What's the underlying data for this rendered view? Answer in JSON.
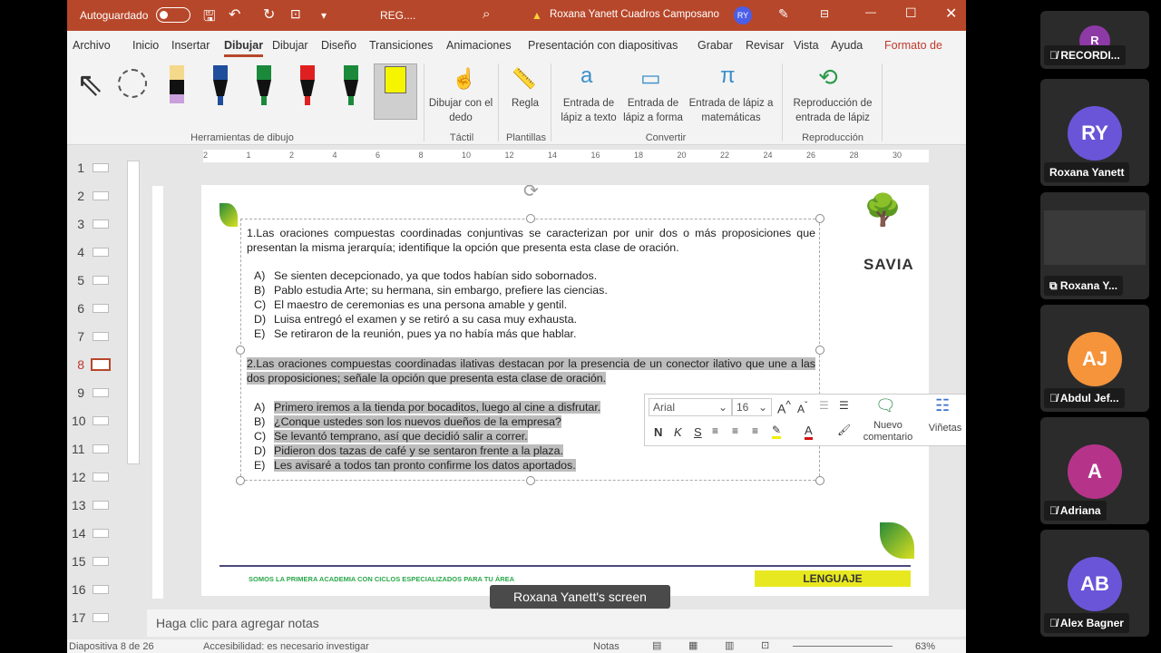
{
  "titlebar": {
    "autosave": "Autoguardado",
    "filename": "REG....",
    "user": "Roxana Yanett Cuadros Camposano",
    "user_initials": "RY",
    "accent": "#b7472a"
  },
  "tabs": [
    "Archivo",
    "Inicio",
    "Insertar",
    "Dibujar",
    "Dibujar",
    "Diseño",
    "Transiciones",
    "Animaciones",
    "Presentación con diapositivas",
    "Grabar",
    "Revisar",
    "Vista",
    "Ayuda",
    "Formato de"
  ],
  "ribbon": {
    "groups": {
      "draw_tools": "Herramientas de dibujo",
      "touch": "Táctil",
      "templates": "Plantillas",
      "convert": "Convertir",
      "replay": "Reproducción"
    },
    "buttons": {
      "draw_finger": "Dibujar con el dedo",
      "ruler": "Regla",
      "ink_text": "Entrada de lápiz a texto",
      "ink_shape": "Entrada de lápiz a forma",
      "ink_math": "Entrada de lápiz a matemáticas",
      "ink_replay": "Reproducción de entrada de lápiz"
    }
  },
  "thumbnails": [
    "1",
    "2",
    "3",
    "4",
    "5",
    "6",
    "7",
    "8",
    "9",
    "10",
    "11",
    "12",
    "13",
    "14",
    "15",
    "16",
    "17"
  ],
  "selected_slide": "8",
  "ruler_labels": [
    "2",
    "1",
    "2",
    "4",
    "6",
    "8",
    "10",
    "12",
    "14",
    "16",
    "18",
    "20",
    "22",
    "24",
    "26",
    "28",
    "30"
  ],
  "slide": {
    "q1": "1.Las oraciones compuestas coordinadas conjuntivas se caracterizan por unir dos o más proposiciones que presentan la misma jerarquía; identifique la opción que presenta esta clase de oración.",
    "q1_options": [
      [
        "A)",
        "Se sienten decepcionado, ya que todos habían sido sobornados."
      ],
      [
        "B)",
        "Pablo estudia Arte; su hermana, sin embargo, prefiere las ciencias."
      ],
      [
        "C)",
        "El maestro de ceremonias es una persona amable y gentil."
      ],
      [
        "D)",
        "Luisa entregó el examen y se retiró a su casa muy exhausta."
      ],
      [
        "E)",
        "Se retiraron de la reunión, pues ya no había más que hablar."
      ]
    ],
    "q2": "2.Las oraciones compuestas coordinadas ilativas destacan por la presencia de un conector ilativo que une a las dos proposiciones; señale la opción que presenta esta clase de oración.",
    "q2_options": [
      [
        "A)",
        "Primero iremos a la tienda por bocaditos, luego al cine a disfrutar."
      ],
      [
        "B)",
        "¿Conque ustedes son los nuevos dueños de la empresa?"
      ],
      [
        "C)",
        "Se levantó temprano, así que decidió salir a correr."
      ],
      [
        "D)",
        "Pidieron dos tazas de café y se sentaron frente a la plaza."
      ],
      [
        "E)",
        "Les avisaré a todos tan pronto confirme los datos aportados."
      ]
    ],
    "logo": "SAVIA",
    "footer_slogan": "SOMOS LA PRIMERA ACADEMIA CON CICLOS ESPECIALIZADOS PARA TU ÁREA",
    "footer_subject": "LENGUAJE"
  },
  "mini_toolbar": {
    "font": "Arial",
    "size": "16",
    "bold": "N",
    "italic": "K",
    "underline": "S",
    "new_comment": "Nuevo comentario",
    "bullets": "Viñetas"
  },
  "notes_placeholder": "Haga clic para agregar notas",
  "status": {
    "slide_info": "Diapositiva 8 de 26",
    "accessibility": "Accesibilidad: es necesario investigar",
    "notes": "Notas",
    "zoom": "63%"
  },
  "screen_caption": "Roxana Yanett's screen",
  "participants": [
    {
      "initials": "R",
      "name": "RECORDI...",
      "color": "#8e3aa6",
      "icon": "mic-off-icon"
    },
    {
      "initials": "RY",
      "name": "Roxana Yanett",
      "color": "#6a55d8",
      "icon": ""
    },
    {
      "initials": "",
      "name": "Roxana Y...",
      "color": "",
      "icon": "screen-share-icon"
    },
    {
      "initials": "AJ",
      "name": "Abdul Jef...",
      "color": "#f5943a",
      "icon": "mic-off-icon"
    },
    {
      "initials": "A",
      "name": "Adriana",
      "color": "#b5348a",
      "icon": "mic-off-icon"
    },
    {
      "initials": "AB",
      "name": "Alex Bagner",
      "color": "#6a55d8",
      "icon": "mic-off-icon"
    }
  ]
}
